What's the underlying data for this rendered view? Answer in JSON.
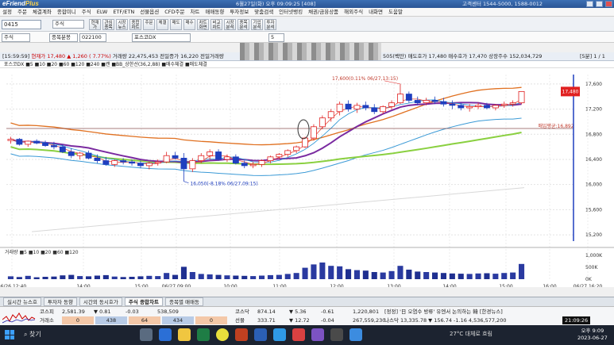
{
  "window": {
    "logo_a": "eFriend",
    "logo_b": "Plus",
    "title_info": "6월27일(화) 오후 09:09:25 [408]",
    "right_info": "고객센터 1544-5000, 1588-0012"
  },
  "menu": [
    "설정",
    "주문",
    "체결계좌",
    "종합미니",
    "주식",
    "ELW",
    "ETF/ETN",
    "선물옵션",
    "CFD주문",
    "차트",
    "매매동향",
    "투자정보",
    "맞춤검색",
    "인터넷뱅킹",
    "채권/금융상품",
    "해외주식",
    "내화면",
    "도움말"
  ],
  "toolbar": {
    "code": "0415",
    "type": "주식",
    "buttons": [
      "현재가",
      "관심종목",
      "시장뉴스",
      "종합차트",
      "주문",
      "체결",
      "매도",
      "매수",
      "차트화면",
      "비교차트",
      "시장분석",
      "종목분석",
      "기업분석",
      "투자분석"
    ]
  },
  "row2": {
    "type": "주식",
    "period_select": "종목분봉",
    "code": "022100",
    "name": "포스코DX",
    "units": [
      "일",
      "주",
      "월",
      "분",
      "틱"
    ],
    "interval": "5"
  },
  "quote": {
    "time": "[15:59:59]",
    "price_label": "현재가",
    "price": "17,480",
    "change": "▲ 1,260",
    "change_pct": "( 7.77%)",
    "volume_label": "거래량",
    "volume": "22,475,453",
    "prev_label": "전일증가",
    "prev": "16,220",
    "prev_vol_label": "전일거래량",
    "tail": "505(백만)  매도호가 17,480  매수호가 17,470  상장주수 152,034,729",
    "right": "[5분] 1 / 1"
  },
  "ma_legend": "포스코DX ■5 ■10 ■20 ■60 ■120 ■240 ■캔 ■BB_상한선(36,2,88) ■매수체결 ■매도체결",
  "chart_data": {
    "type": "candlestick",
    "price_axis": [
      "17,600",
      "17,200",
      "16,800",
      "16,400",
      "16,000",
      "15,600",
      "15,200"
    ],
    "time_axis": [
      "06/26,12:40",
      "14:00",
      "15:00",
      "06/27,09:00",
      "10:00",
      "11:00",
      "12:00",
      "13:00",
      "14:00",
      "15:00",
      "16:00",
      "06/27,16:20"
    ],
    "max_note": "17,600(0.11% 06/27,13:15)",
    "min_note": "16,050(-8.18% 06/27,09:15)",
    "avg_label": "매입평균:16,892",
    "last_price": "17,480",
    "volume_axis": [
      "1,000K",
      "500K",
      "0K"
    ],
    "vol_legend": "거래량 ■5 ■10 ■20 ■60 ■120",
    "candles": [
      [
        16700,
        16760,
        16650,
        16720
      ],
      [
        16720,
        16740,
        16620,
        16640
      ],
      [
        16640,
        16700,
        16600,
        16690
      ],
      [
        16690,
        16720,
        16640,
        16660
      ],
      [
        16660,
        16700,
        16600,
        16620
      ],
      [
        16620,
        16680,
        16560,
        16600
      ],
      [
        16600,
        16640,
        16500,
        16520
      ],
      [
        16520,
        16580,
        16420,
        16460
      ],
      [
        16460,
        16520,
        16400,
        16500
      ],
      [
        16500,
        16540,
        16400,
        16420
      ],
      [
        16420,
        16480,
        16340,
        16380
      ],
      [
        16380,
        16440,
        16300,
        16320
      ],
      [
        16320,
        16400,
        16280,
        16380
      ],
      [
        16380,
        16420,
        16320,
        16360
      ],
      [
        16360,
        16400,
        16300,
        16340
      ],
      [
        16340,
        16380,
        16260,
        16300
      ],
      [
        16300,
        16360,
        16240,
        16340
      ],
      [
        16340,
        16400,
        16300,
        16360
      ],
      [
        16360,
        16520,
        16340,
        16460
      ],
      [
        16460,
        16520,
        16400,
        16420
      ],
      [
        16420,
        16500,
        16050,
        16250
      ],
      [
        16250,
        16420,
        16200,
        16380
      ],
      [
        16380,
        16500,
        16340,
        16460
      ],
      [
        16460,
        16560,
        16400,
        16520
      ],
      [
        16520,
        16560,
        16380,
        16400
      ],
      [
        16400,
        16480,
        16360,
        16440
      ],
      [
        16440,
        16480,
        16320,
        16340
      ],
      [
        16340,
        16380,
        16260,
        16300
      ],
      [
        16300,
        16360,
        16260,
        16320
      ],
      [
        16320,
        16400,
        16280,
        16380
      ],
      [
        16380,
        16460,
        16340,
        16440
      ],
      [
        16440,
        16500,
        16400,
        16480
      ],
      [
        16480,
        16560,
        16440,
        16540
      ],
      [
        16540,
        16620,
        16500,
        16600
      ],
      [
        16600,
        16760,
        16580,
        16740
      ],
      [
        16740,
        16960,
        16700,
        16920
      ],
      [
        16920,
        17100,
        16880,
        17060
      ],
      [
        17060,
        17200,
        17000,
        17160
      ],
      [
        17160,
        17320,
        17100,
        17280
      ],
      [
        17280,
        17340,
        17160,
        17200
      ],
      [
        17200,
        17300,
        17140,
        17260
      ],
      [
        17260,
        17320,
        17180,
        17220
      ],
      [
        17220,
        17280,
        17120,
        17160
      ],
      [
        17160,
        17260,
        17120,
        17240
      ],
      [
        17240,
        17340,
        17200,
        17300
      ],
      [
        17300,
        17600,
        17280,
        17440
      ],
      [
        17440,
        17480,
        17300,
        17340
      ],
      [
        17340,
        17400,
        17260,
        17300
      ],
      [
        17300,
        17380,
        17260,
        17340
      ],
      [
        17340,
        17400,
        17280,
        17320
      ],
      [
        17320,
        17380,
        17240,
        17280
      ],
      [
        17280,
        17340,
        17200,
        17260
      ],
      [
        17260,
        17300,
        17180,
        17220
      ],
      [
        17220,
        17280,
        17160,
        17240
      ],
      [
        17240,
        17300,
        17200,
        17260
      ],
      [
        17260,
        17300,
        17200,
        17220
      ],
      [
        17220,
        17280,
        17180,
        17260
      ],
      [
        17260,
        17320,
        17220,
        17280
      ],
      [
        17280,
        17340,
        17240,
        17300
      ],
      [
        17300,
        17480,
        17280,
        17480
      ]
    ],
    "volumes": [
      120,
      90,
      140,
      80,
      100,
      110,
      160,
      180,
      130,
      120,
      150,
      170,
      110,
      90,
      100,
      120,
      140,
      130,
      260,
      180,
      520,
      300,
      220,
      200,
      180,
      160,
      150,
      140,
      130,
      150,
      170,
      180,
      220,
      260,
      480,
      620,
      700,
      560,
      540,
      420,
      380,
      360,
      300,
      280,
      340,
      560,
      400,
      320,
      300,
      280,
      260,
      240,
      230,
      220,
      240,
      250,
      230,
      260,
      280,
      640
    ]
  },
  "tabs": [
    "실시간 뉴스호",
    "투자자 동향",
    "시간외 동시호가",
    "주식 종합차트",
    "종목별 매매동"
  ],
  "bottom": {
    "r1": [
      "코스피",
      "2,581.39",
      "▼ 0.81",
      "-0.03",
      "538,509"
    ],
    "r2": [
      "거래소",
      "0",
      "438",
      "64",
      "434",
      "0"
    ],
    "r3": [
      "코스닥",
      "874.14",
      "▼ 5.36",
      "-0.61",
      "1,220,801"
    ],
    "r4": [
      "선물",
      "333.71",
      "▼ 12.72",
      "-0.04",
      "267,559,230"
    ],
    "news": "[정정] '日 오염수 방류' 유엔서 논의하는 韓 [한경뉴스]",
    "nas": "나스닥  13,335.78  ▼ 156.74  -1.16  4,536,577,200",
    "time": "21:09:26"
  },
  "taskbar": {
    "search": "찾기",
    "weather": "27°C 대체로 흐림",
    "time": "오후 9:09",
    "date": "2023-06-27"
  }
}
